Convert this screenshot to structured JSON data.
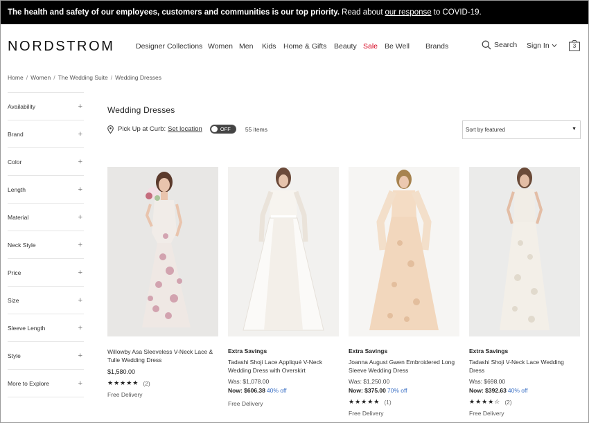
{
  "banner": {
    "strong": "The health and safety of our employees, customers and communities is our top priority.",
    "pre_link": "Read about",
    "link": "our response",
    "post_link": "to COVID-19."
  },
  "header": {
    "logo": "NORDSTROM",
    "nav": [
      "Designer Collections",
      "Women",
      "Men",
      "Kids",
      "Home & Gifts",
      "Beauty",
      "Sale",
      "Be Well",
      "Brands"
    ],
    "search_label": "Search",
    "signin_label": "Sign In",
    "bag_count": "3"
  },
  "breadcrumb": [
    "Home",
    "Women",
    "The Wedding Suite",
    "Wedding Dresses"
  ],
  "filters": [
    "Availability",
    "Brand",
    "Color",
    "Length",
    "Material",
    "Neck Style",
    "Price",
    "Size",
    "Sleeve Length",
    "Style",
    "More to Explore"
  ],
  "results": {
    "title": "Wedding Dresses",
    "pickup_label": "Pick Up at Curb:",
    "set_location": "Set location",
    "toggle_state": "OFF",
    "item_count": "55 items",
    "sort_label": "Sort by featured"
  },
  "products": [
    {
      "tag": "",
      "name": "Willowby Asa Sleeveless V-Neck Lace & Tulle Wedding Dress",
      "price": "$1,580.00",
      "was": "",
      "now_label": "",
      "now_price": "",
      "off": "",
      "stars": "★★★★★",
      "reviews": "(2)",
      "delivery": "Free Delivery"
    },
    {
      "tag": "Extra Savings",
      "name": "Tadashi Shoji Lace Appliqué V-Neck Wedding Dress with Overskirt",
      "price": "",
      "was": "Was: $1,078.00",
      "now_label": "Now: $606.38",
      "now_price": "",
      "off": "40% off",
      "stars": "",
      "reviews": "",
      "delivery": "Free Delivery"
    },
    {
      "tag": "Extra Savings",
      "name": "Joanna August Gwen Embroidered Long Sleeve Wedding Dress",
      "price": "",
      "was": "Was: $1,250.00",
      "now_label": "Now: $375.00",
      "now_price": "",
      "off": "70% off",
      "stars": "★★★★★",
      "reviews": "(1)",
      "delivery": "Free Delivery"
    },
    {
      "tag": "Extra Savings",
      "name": "Tadashi Shoji V-Neck Lace Wedding Dress",
      "price": "",
      "was": "Was: $698.00",
      "now_label": "Now: $392.63",
      "now_price": "",
      "off": "40% off",
      "stars": "★★★★☆",
      "reviews": "(2)",
      "delivery": "Free Delivery"
    }
  ],
  "colors": {
    "banner_bg": "#000000",
    "sale": "#d6001c",
    "discount": "#3a6fc4"
  }
}
